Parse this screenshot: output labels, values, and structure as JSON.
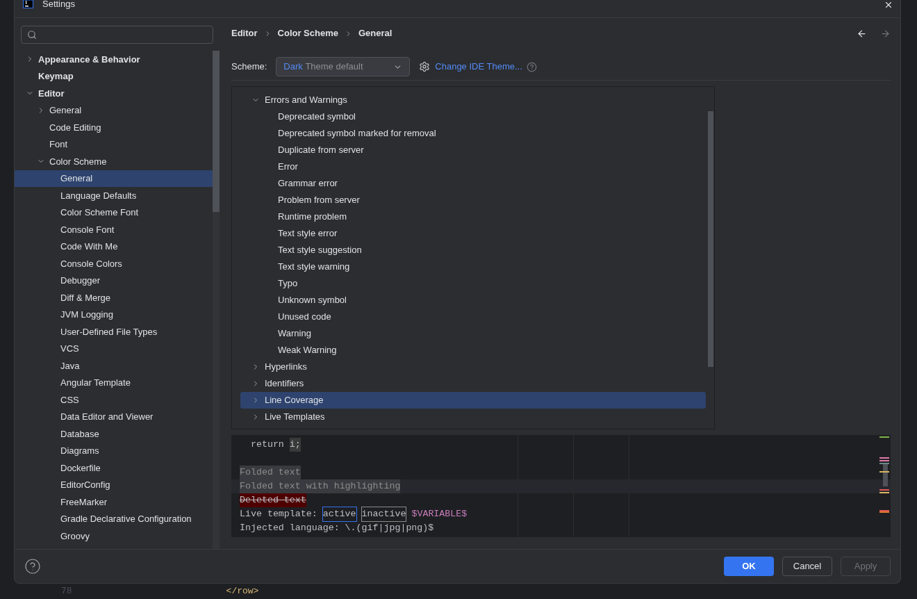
{
  "window": {
    "title": "Settings"
  },
  "sidebar": {
    "items": [
      {
        "label": "Appearance & Behavior",
        "bold": true,
        "expanded": false,
        "selected": false
      },
      {
        "label": "Keymap",
        "bold": true,
        "selected": false
      },
      {
        "label": "Editor",
        "bold": true,
        "expanded": true,
        "selected": false,
        "children": [
          {
            "label": "General",
            "expanded": false,
            "selected": false
          },
          {
            "label": "Code Editing",
            "selected": false
          },
          {
            "label": "Font",
            "selected": false
          },
          {
            "label": "Color Scheme",
            "expanded": true,
            "selected": false,
            "children": [
              {
                "label": "General",
                "selected": true
              },
              {
                "label": "Language Defaults",
                "selected": false
              },
              {
                "label": "Color Scheme Font",
                "selected": false
              },
              {
                "label": "Console Font",
                "selected": false
              },
              {
                "label": "Code With Me",
                "selected": false
              },
              {
                "label": "Console Colors",
                "selected": false
              },
              {
                "label": "Debugger",
                "selected": false
              },
              {
                "label": "Diff & Merge",
                "selected": false
              },
              {
                "label": "JVM Logging",
                "selected": false
              },
              {
                "label": "User-Defined File Types",
                "selected": false
              },
              {
                "label": "VCS",
                "selected": false
              },
              {
                "label": "Java",
                "selected": false
              },
              {
                "label": "Angular Template",
                "selected": false
              },
              {
                "label": "CSS",
                "selected": false
              },
              {
                "label": "Data Editor and Viewer",
                "selected": false
              },
              {
                "label": "Database",
                "selected": false
              },
              {
                "label": "Diagrams",
                "selected": false
              },
              {
                "label": "Dockerfile",
                "selected": false
              },
              {
                "label": "EditorConfig",
                "selected": false
              },
              {
                "label": "FreeMarker",
                "selected": false
              },
              {
                "label": "Gradle Declarative Configuration",
                "selected": false
              },
              {
                "label": "Groovy",
                "selected": false
              }
            ]
          }
        ]
      }
    ]
  },
  "breadcrumb": [
    "Editor",
    "Color Scheme",
    "General"
  ],
  "scheme": {
    "label": "Scheme:",
    "value_match": "Dark",
    "value_rest": "Theme default",
    "link": "Change IDE Theme..."
  },
  "options_tree": [
    {
      "label": "Errors and Warnings",
      "expanded": true,
      "selected": false,
      "children": [
        {
          "label": "Deprecated symbol",
          "selected": false
        },
        {
          "label": "Deprecated symbol marked for removal",
          "selected": false
        },
        {
          "label": "Duplicate from server",
          "selected": false
        },
        {
          "label": "Error",
          "selected": false
        },
        {
          "label": "Grammar error",
          "selected": false
        },
        {
          "label": "Problem from server",
          "selected": false
        },
        {
          "label": "Runtime problem",
          "selected": false
        },
        {
          "label": "Text style error",
          "selected": false
        },
        {
          "label": "Text style suggestion",
          "selected": false
        },
        {
          "label": "Text style warning",
          "selected": false
        },
        {
          "label": "Typo",
          "selected": false
        },
        {
          "label": "Unknown symbol",
          "selected": false
        },
        {
          "label": "Unused code",
          "selected": false
        },
        {
          "label": "Warning",
          "selected": false
        },
        {
          "label": "Weak Warning",
          "selected": false
        }
      ]
    },
    {
      "label": "Hyperlinks",
      "expanded": false,
      "selected": false
    },
    {
      "label": "Identifiers",
      "expanded": false,
      "selected": false
    },
    {
      "label": "Line Coverage",
      "expanded": false,
      "selected": true
    },
    {
      "label": "Live Templates",
      "expanded": false,
      "selected": false
    }
  ],
  "preview": {
    "lines": [
      {
        "highlighted": false,
        "segments": [
          {
            "kind": "plain",
            "text": "  return "
          },
          {
            "kind": "usage",
            "text": "i;"
          }
        ]
      },
      {
        "highlighted": false
      },
      {
        "highlighted": false,
        "segments": [
          {
            "kind": "folded",
            "text": "Folded text"
          }
        ]
      },
      {
        "highlighted": true,
        "segments": [
          {
            "kind": "folded",
            "text": "Folded text with highlighting"
          }
        ]
      },
      {
        "highlighted": false,
        "segments": [
          {
            "kind": "deleted",
            "text": "Deleted text"
          }
        ]
      },
      {
        "highlighted": false,
        "segments": [
          {
            "kind": "plain",
            "text": "Live template: "
          },
          {
            "kind": "active",
            "text": "active"
          },
          {
            "kind": "inactive",
            "text": "inactive"
          },
          {
            "kind": "variable",
            "text": "$VARIABLE$"
          }
        ]
      },
      {
        "highlighted": false,
        "segments": [
          {
            "kind": "plain",
            "text": "Injected language: \\.(gif|jpg|png)$"
          }
        ]
      }
    ]
  },
  "buttons": [
    {
      "label": "OK",
      "kind": "primary",
      "disabled": false
    },
    {
      "label": "Cancel",
      "kind": "normal",
      "disabled": false
    },
    {
      "label": "Apply",
      "kind": "normal",
      "disabled": true
    }
  ],
  "background_editor": {
    "line_number": "78",
    "code": "</row>"
  }
}
